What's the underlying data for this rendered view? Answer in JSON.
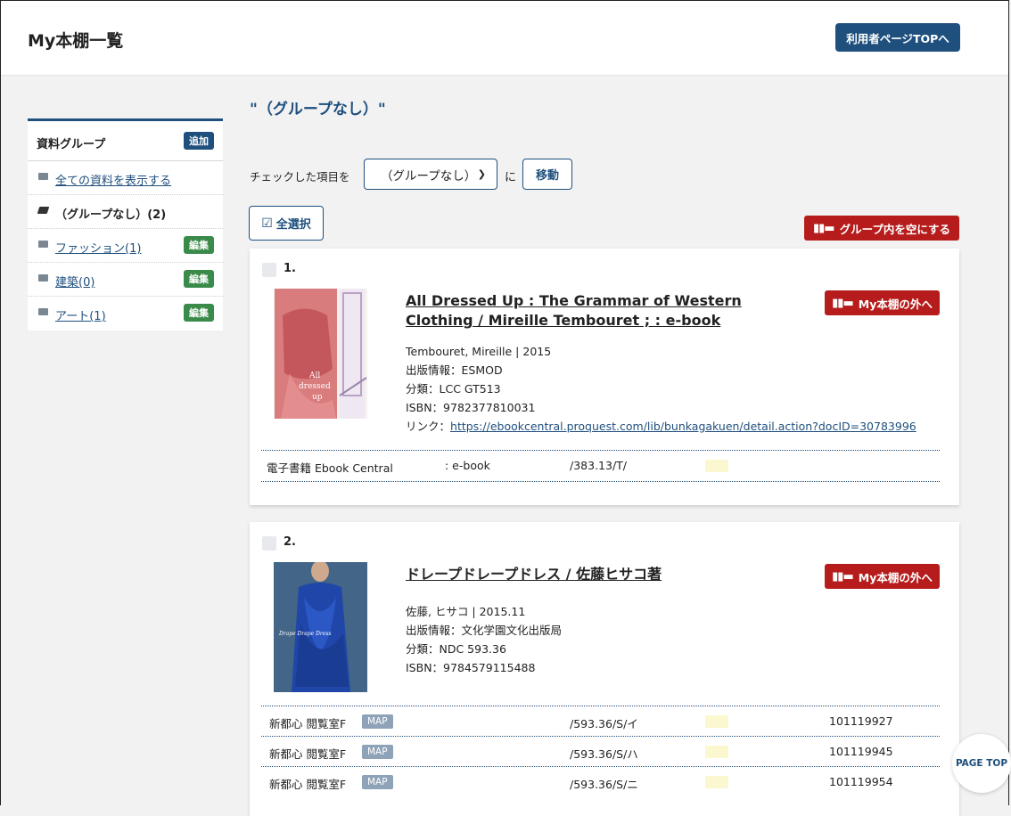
{
  "header": {
    "title": "My本棚一覧",
    "top_button": "利用者ページTOPへ"
  },
  "sidebar": {
    "heading": "資料グループ",
    "add_label": "追加",
    "edit_label": "編集",
    "items": [
      {
        "label": "全ての資料を表示する"
      },
      {
        "label": "（グループなし）(2)"
      },
      {
        "label": "ファッション(1)"
      },
      {
        "label": "建築(0)"
      },
      {
        "label": "アート(1)"
      }
    ]
  },
  "main": {
    "group_title": "\"（グループなし）\"",
    "move_label": "チェックした項目を",
    "move_select": "（グループなし）",
    "move_ni": "に",
    "move_button": "移動",
    "select_all": "全選択",
    "empty_button": "グループ内を空にする",
    "remove_label": "My本棚の外へ",
    "page_top": "PAGE TOP"
  },
  "books": [
    {
      "number": "1.",
      "title": "All Dressed Up : The Grammar of Western Clothing / Mireille Tembouret ; : e-book",
      "author_year": "Tembouret, Mireille | 2015",
      "publisher": "出版情報：ESMOD",
      "classification": "分類：LCC GT513",
      "isbn": "ISBN：9782377810031",
      "link_prefix": "リンク：",
      "link": "https://ebookcentral.proquest.com/lib/bunkagakuen/detail.action?docID=30783996",
      "holdings": [
        {
          "location": "電子書籍 Ebook Central",
          "material": ": e-book",
          "call_number": "/383.13/T/",
          "id": ""
        }
      ]
    },
    {
      "number": "2.",
      "title": "ドレープドレープドレス / 佐藤ヒサコ著",
      "author_year": "佐藤, ヒサコ | 2015.11",
      "publisher": "出版情報：文化学園文化出版局",
      "classification": "分類：NDC 593.36",
      "isbn": "ISBN：9784579115488",
      "map_label": "MAP",
      "holdings": [
        {
          "location": "新都心 閲覧室F",
          "call_number": "/593.36/S/イ",
          "id": "101119927"
        },
        {
          "location": "新都心 閲覧室F",
          "call_number": "/593.36/S/ハ",
          "id": "101119945"
        },
        {
          "location": "新都心 閲覧室F",
          "call_number": "/593.36/S/ニ",
          "id": "101119954"
        }
      ]
    }
  ],
  "colors": {
    "primary": "#1f4f7d",
    "danger": "#b71c1c",
    "edit": "#3a8a4a",
    "map": "#8ea3b8"
  }
}
